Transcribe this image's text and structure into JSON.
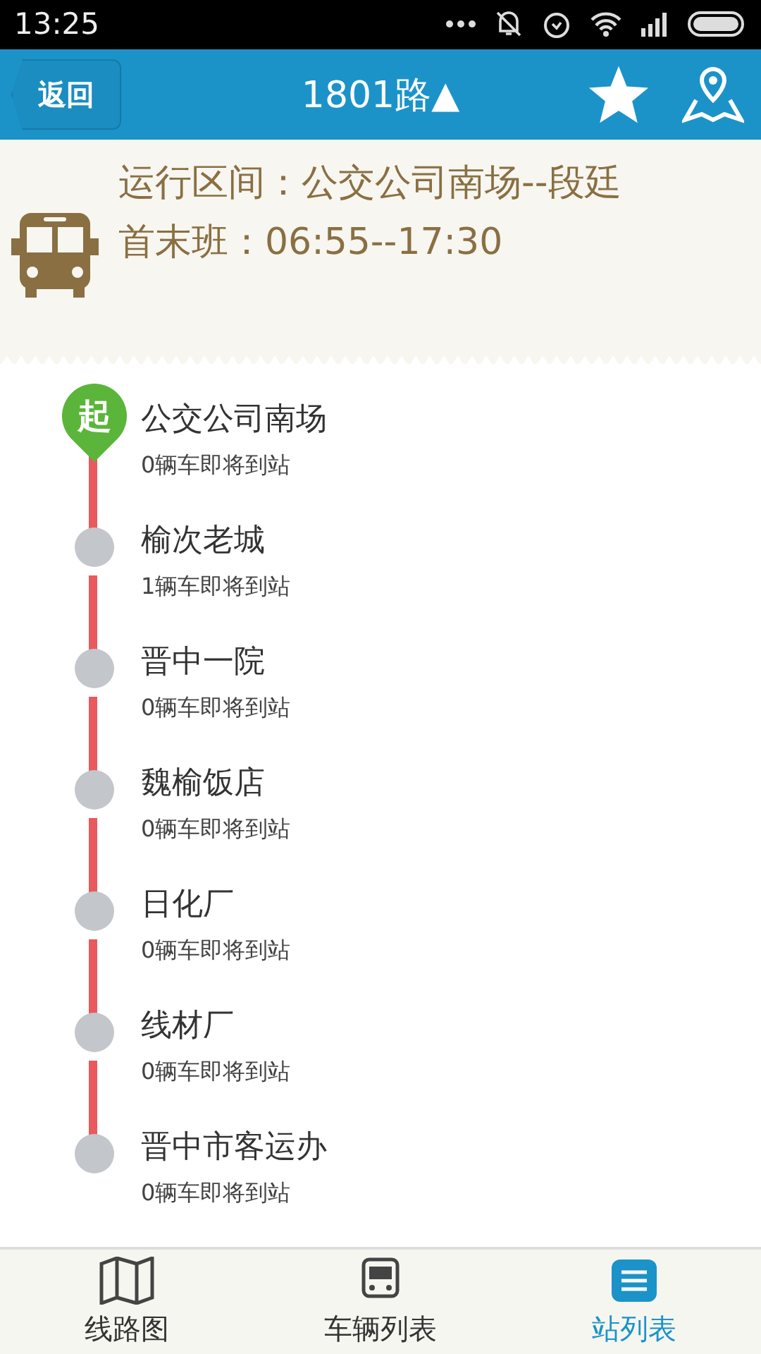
{
  "status_bar": {
    "time": "13:25"
  },
  "header": {
    "back": "返回",
    "title": "1801路▲"
  },
  "info": {
    "range": "运行区间：公交公司南场--段廷",
    "schedule": "首末班：06:55--17:30"
  },
  "stations": [
    {
      "kind": "start",
      "badge": "起",
      "name": "公交公司南场",
      "arrivals": "0辆车即将到站"
    },
    {
      "kind": "stop",
      "name": "榆次老城",
      "arrivals": "1辆车即将到站"
    },
    {
      "kind": "stop",
      "name": "晋中一院",
      "arrivals": "0辆车即将到站"
    },
    {
      "kind": "stop",
      "name": "魏榆饭店",
      "arrivals": "0辆车即将到站"
    },
    {
      "kind": "stop",
      "name": "日化厂",
      "arrivals": "0辆车即将到站"
    },
    {
      "kind": "stop",
      "name": "线材厂",
      "arrivals": "0辆车即将到站"
    },
    {
      "kind": "stop",
      "name": "晋中市客运办",
      "arrivals": "0辆车即将到站"
    }
  ],
  "tabs": [
    {
      "kind": "map",
      "label": "线路图",
      "selected": false
    },
    {
      "kind": "bus",
      "label": "车辆列表",
      "selected": false
    },
    {
      "kind": "list",
      "label": "站列表",
      "selected": true
    }
  ]
}
